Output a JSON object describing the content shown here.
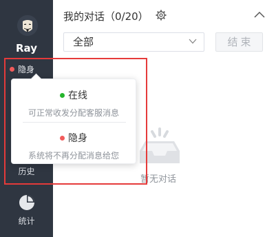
{
  "sidebar": {
    "user_name": "Ray",
    "status_label": "隐身",
    "nav_history_label": "历史",
    "nav_stats_label": "统计"
  },
  "header": {
    "title": "我的对话（0/20）"
  },
  "filter": {
    "selected": "全部"
  },
  "end_button_label": "结束",
  "empty_state_text": "暂无对话",
  "status_menu": {
    "options": [
      {
        "label": "在线",
        "description": "可正常收发分配客服消息",
        "color": "#25b52d"
      },
      {
        "label": "隐身",
        "description": "系统将不再分配消息给您",
        "color": "#f25b5b"
      }
    ]
  },
  "colors": {
    "sidebar_bg": "#2f3641",
    "highlight_frame": "#e53a3a"
  }
}
